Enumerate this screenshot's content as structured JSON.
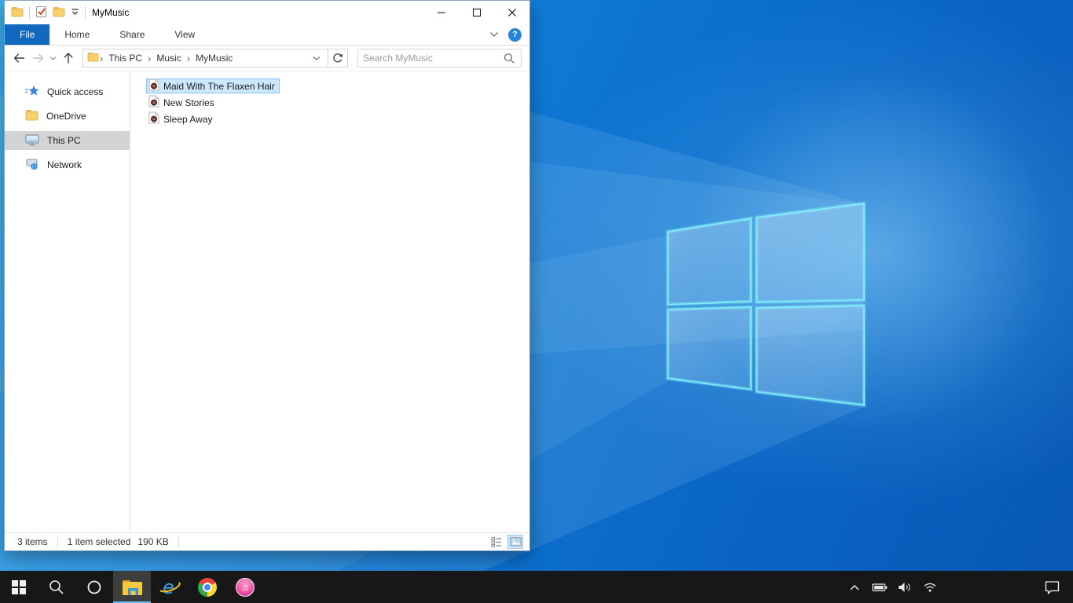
{
  "colors": {
    "accent_blue": "#1168be",
    "file_selection_bg": "#cce8ff",
    "file_selection_border": "#84c3f5",
    "sidebar_selected_bg": "#d4d4d4",
    "taskbar_bg": "#171717",
    "taskbar_active_underline": "#6cb8f0",
    "wallpaper_deep_blue": "#0857b4",
    "wallpaper_light_blue": "#2ba6ea",
    "logo_edge_cyan": "#7deef8",
    "help_icon_bg": "#2283d8"
  },
  "icons": {
    "breadcrumb_separator": "›",
    "help_glyph": "?",
    "ie_glyph": "e",
    "itunes_note_glyph": "♫"
  },
  "window": {
    "title": "MyMusic",
    "titlebar_icons": [
      "explorer-window-icon",
      "properties-qat-icon",
      "new-folder-qat-icon",
      "customize-qat-icon"
    ],
    "ribbon": {
      "tabs": [
        {
          "label": "File",
          "active": true
        },
        {
          "label": "Home",
          "active": false
        },
        {
          "label": "Share",
          "active": false
        },
        {
          "label": "View",
          "active": false
        }
      ]
    },
    "addressbar": {
      "breadcrumb": [
        "This PC",
        "Music",
        "MyMusic"
      ],
      "search_placeholder": "Search MyMusic"
    },
    "sidebar": {
      "items": [
        {
          "label": "Quick access",
          "icon": "quick-access-star-icon",
          "selected": false
        },
        {
          "label": "OneDrive",
          "icon": "onedrive-folder-icon",
          "selected": false
        },
        {
          "label": "This PC",
          "icon": "this-pc-monitor-icon",
          "selected": true
        },
        {
          "label": "Network",
          "icon": "network-icon",
          "selected": false
        }
      ]
    },
    "files": [
      {
        "name": "Maid With The Flaxen Hair",
        "icon": "audio-file-icon",
        "selected": true
      },
      {
        "name": "New Stories",
        "icon": "audio-file-icon",
        "selected": false
      },
      {
        "name": "Sleep Away",
        "icon": "audio-file-icon",
        "selected": false
      }
    ],
    "statusbar": {
      "items_count": "3 items",
      "selection_summary": "1 item selected",
      "selection_size": "190 KB",
      "view_buttons": [
        "details-view",
        "large-thumbnails-view"
      ],
      "active_view": "large-thumbnails-view"
    }
  },
  "taskbar": {
    "buttons": [
      {
        "name": "start",
        "icon": "windows-logo-icon",
        "active": false
      },
      {
        "name": "search",
        "icon": "magnifier-icon",
        "active": false
      },
      {
        "name": "cortana",
        "icon": "circle-icon",
        "active": false
      },
      {
        "name": "file-explorer",
        "icon": "folder-icon",
        "active": true
      },
      {
        "name": "internet-explorer",
        "icon": "ie-icon",
        "active": false
      },
      {
        "name": "chrome",
        "icon": "chrome-icon",
        "active": false
      },
      {
        "name": "itunes",
        "icon": "music-note-icon",
        "active": false
      }
    ],
    "tray": [
      {
        "name": "show-hidden-icons",
        "icon": "chevron-up-icon"
      },
      {
        "name": "battery",
        "icon": "battery-icon"
      },
      {
        "name": "volume",
        "icon": "speaker-icon"
      },
      {
        "name": "wifi",
        "icon": "wifi-icon"
      }
    ],
    "action_center": {
      "icon": "notification-bubble-icon"
    }
  }
}
